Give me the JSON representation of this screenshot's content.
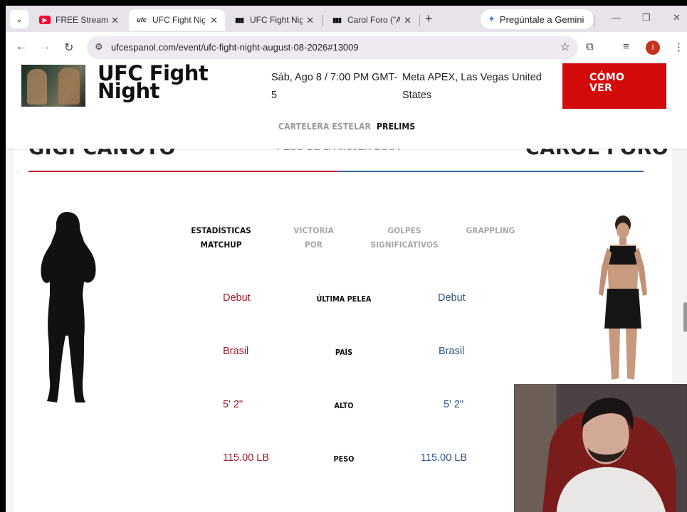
{
  "browser": {
    "tabs": [
      {
        "title": "FREE Stream S",
        "icon": "youtube-icon",
        "active": false
      },
      {
        "title": "UFC Fight Nig",
        "icon": "ufc-icon",
        "active": true
      },
      {
        "title": "UFC Fight Nig",
        "icon": "ufc-bars-icon",
        "active": false
      },
      {
        "title": "Carol Foro (\"A",
        "icon": "ufc-bars-icon",
        "active": false
      }
    ],
    "gemini_label": "Pregúntale a Gemini",
    "url": "ufcespanol.com/event/ufc-fight-night-august-08-2026#13009",
    "profile_initial": "I"
  },
  "event": {
    "title": "UFC Fight Night",
    "date": "Sáb, Ago 8 / 7:00 PM GMT-5",
    "venue": "Meta APEX, Las Vegas United States",
    "watch_button": "CÓMO VER"
  },
  "card_nav": {
    "tabs": [
      {
        "label": "CARTELERA ESTELAR",
        "active": false
      },
      {
        "label": "PRELIMS",
        "active": true
      }
    ]
  },
  "bout": {
    "red_name_partial": "GIGI CANOTO",
    "blue_name_partial": "CAROL FORO",
    "weight_class_partial": "PESO DE LA MUJER BOUT"
  },
  "stat_tabs": [
    {
      "line1": "ESTADÍSTICAS",
      "line2": "MATCHUP",
      "active": true
    },
    {
      "line1": "VICTORIA",
      "line2": "POR",
      "active": false
    },
    {
      "line1": "GOLPES",
      "line2": "SIGNIFICATIVOS",
      "active": false
    },
    {
      "line1": "GRAPPLING",
      "line2": "",
      "active": false
    }
  ],
  "stats": [
    {
      "label": "ÚLTIMA PELEA",
      "red": "Debut",
      "blue": "Debut"
    },
    {
      "label": "PAÍS",
      "red": "Brasil",
      "blue": "Brasil"
    },
    {
      "label": "ALTO",
      "red": "5' 2\"",
      "blue": "5' 2\""
    },
    {
      "label": "PESO",
      "red": "115.00 LB",
      "blue": "115.00 LB"
    }
  ],
  "colors": {
    "ufc_red": "#d20a0a",
    "red_corner": "#a41926",
    "blue_corner": "#2e5583"
  }
}
